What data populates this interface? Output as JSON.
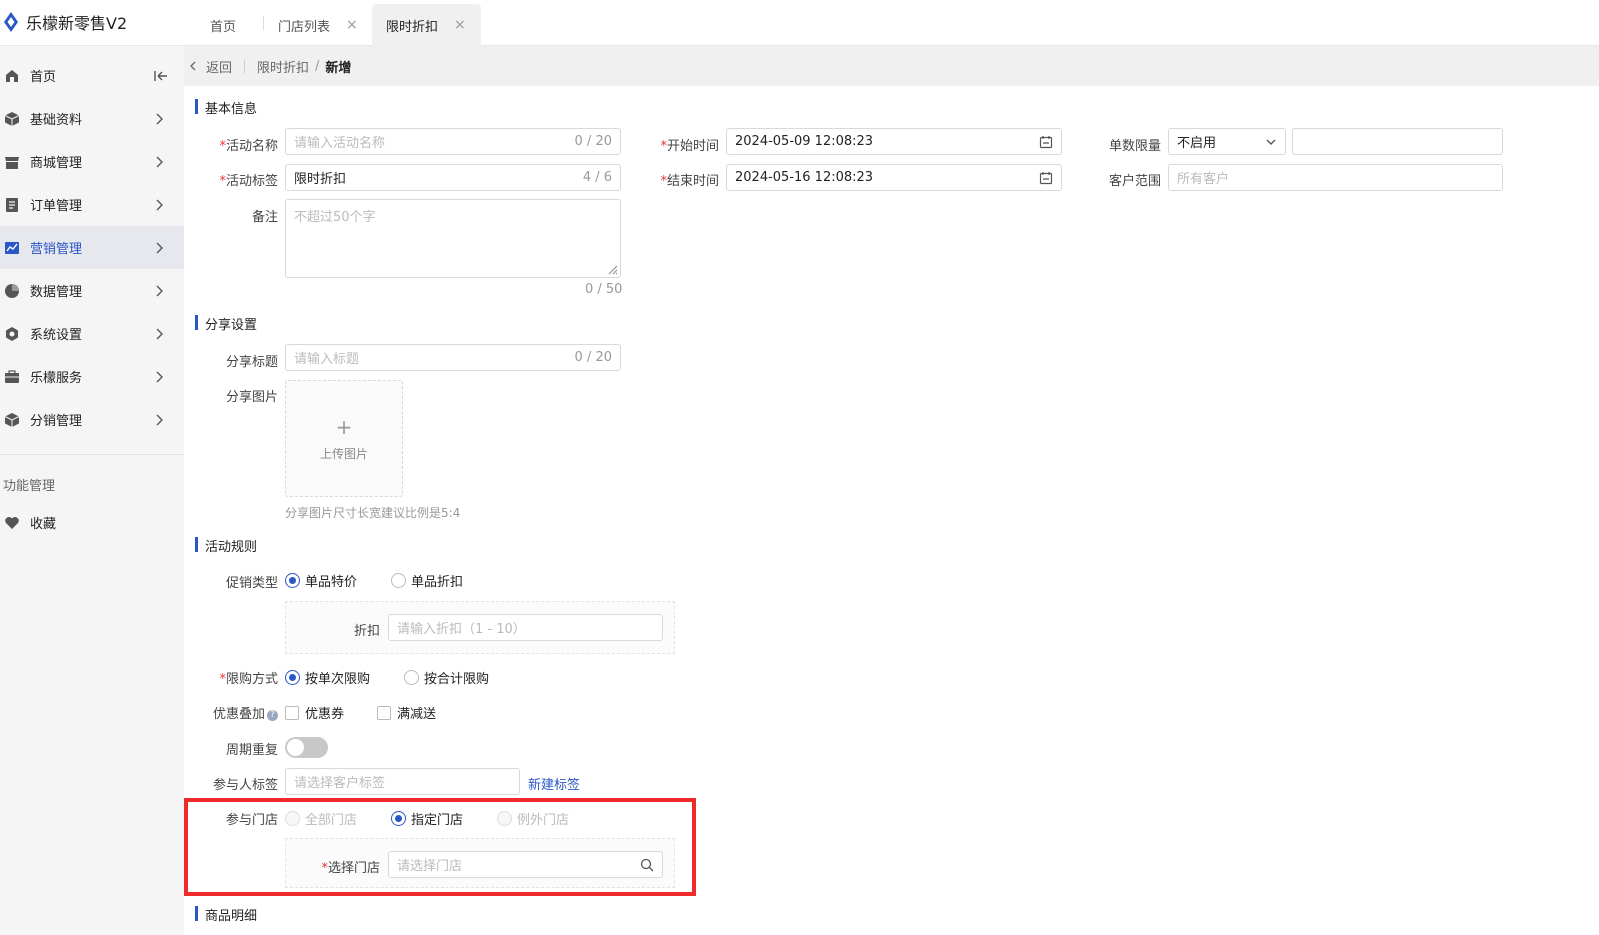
{
  "app": {
    "title": "乐檬新零售V2"
  },
  "tabs": [
    {
      "label": "首页"
    },
    {
      "label": "门店列表",
      "close": "×"
    },
    {
      "label": "限时折扣",
      "close": "×"
    }
  ],
  "sidebar": {
    "items": [
      {
        "label": "首页"
      },
      {
        "label": "基础资料"
      },
      {
        "label": "商城管理"
      },
      {
        "label": "订单管理"
      },
      {
        "label": "营销管理"
      },
      {
        "label": "数据管理"
      },
      {
        "label": "系统设置"
      },
      {
        "label": "乐檬服务"
      },
      {
        "label": "分销管理"
      }
    ],
    "group_label": "功能管理",
    "favorite_label": "收藏",
    "active_color": "#2a56c6"
  },
  "breadcrumb": {
    "back": "返回",
    "parent": "限时折扣",
    "separator": "/",
    "current": "新增"
  },
  "basic": {
    "title": "基本信息",
    "name": {
      "label": "活动名称",
      "placeholder": "请输入活动名称",
      "count": "0 / 20"
    },
    "tag": {
      "label": "活动标签",
      "value": "限时折扣",
      "count": "4 / 6"
    },
    "remark": {
      "label": "备注",
      "placeholder": "不超过50个字",
      "count": "0 / 50"
    },
    "start": {
      "label": "开始时间",
      "value": "2024-05-09 12:08:23"
    },
    "end": {
      "label": "结束时间",
      "value": "2024-05-16 12:08:23"
    },
    "limit": {
      "label": "单数限量",
      "value": "不启用"
    },
    "customer": {
      "label": "客户范围",
      "placeholder": "所有客户"
    }
  },
  "share": {
    "title": "分享设置",
    "share_title": {
      "label": "分享标题",
      "placeholder": "请输入标题",
      "count": "0 / 20"
    },
    "image": {
      "label": "分享图片",
      "plus": "+",
      "upload": "上传图片",
      "hint": "分享图片尺寸长宽建议比例是5:4"
    }
  },
  "rules": {
    "title": "活动规则",
    "promo_type": {
      "label": "促销类型",
      "options": [
        "单品特价",
        "单品折扣"
      ],
      "selected": 0
    },
    "discount": {
      "label": "折扣",
      "placeholder": "请输入折扣（1 - 10）"
    },
    "limit_mode": {
      "label": "限购方式",
      "options": [
        "按单次限购",
        "按合计限购"
      ],
      "selected": 0
    },
    "stack": {
      "label": "优惠叠加",
      "help": "?",
      "options": [
        "优惠券",
        "满减送"
      ]
    },
    "repeat": {
      "label": "周期重复",
      "on": false
    },
    "tags": {
      "label": "参与人标签",
      "placeholder": "请选择客户标签",
      "link": "新建标签"
    },
    "stores": {
      "label": "参与门店",
      "options": [
        "全部门店",
        "指定门店",
        "例外门店"
      ],
      "selected": 1
    },
    "select_store": {
      "label": "选择门店",
      "placeholder": "请选择门店"
    }
  },
  "goods": {
    "title": "商品明细"
  },
  "required_mark": "*",
  "highlight_color": "#ee2a2a"
}
